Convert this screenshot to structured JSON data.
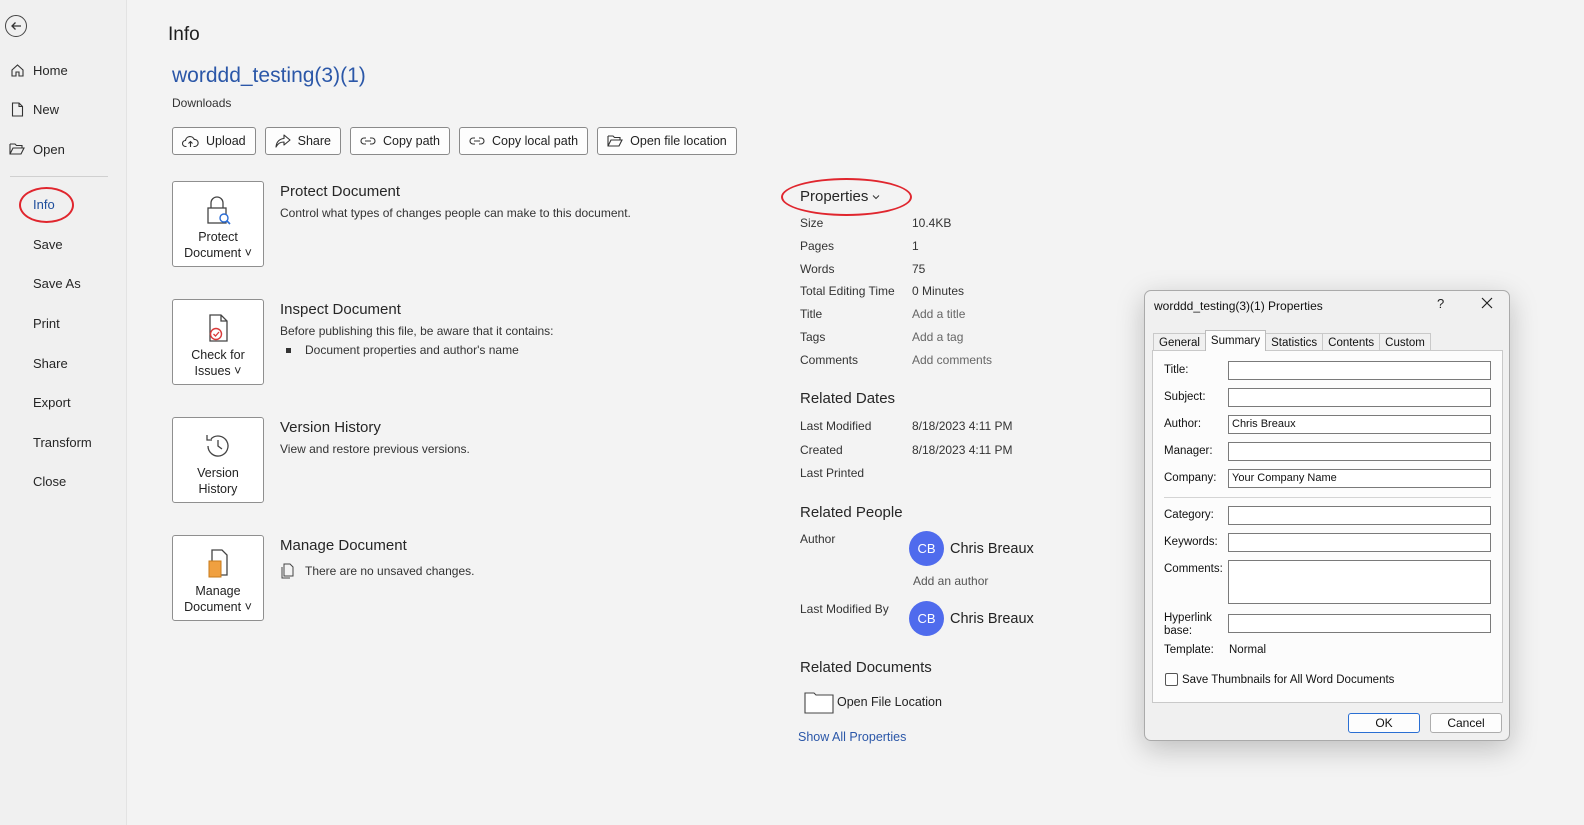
{
  "sidebar": {
    "items": [
      {
        "label": "Home",
        "icon": "home-icon"
      },
      {
        "label": "New",
        "icon": "new-document-icon"
      },
      {
        "label": "Open",
        "icon": "folder-open-icon"
      },
      {
        "label": "Info"
      },
      {
        "label": "Save"
      },
      {
        "label": "Save As"
      },
      {
        "label": "Print"
      },
      {
        "label": "Share"
      },
      {
        "label": "Export"
      },
      {
        "label": "Transform"
      },
      {
        "label": "Close"
      }
    ],
    "active": "Info"
  },
  "page": {
    "title": "Info",
    "doc_name": "worddd_testing(3)(1)",
    "doc_location": "Downloads"
  },
  "toolbar": {
    "upload": "Upload",
    "share": "Share",
    "copy_path": "Copy path",
    "copy_local_path": "Copy local path",
    "open_file_location": "Open file location"
  },
  "sections": {
    "protect": {
      "tile_line1": "Protect",
      "tile_line2": "Document",
      "title": "Protect Document",
      "desc": "Control what types of changes people can make to this document."
    },
    "inspect": {
      "tile_line1": "Check for",
      "tile_line2": "Issues",
      "title": "Inspect Document",
      "desc": "Before publishing this file, be aware that it contains:",
      "bullet": "Document properties and author's name"
    },
    "version": {
      "tile_line1": "Version",
      "tile_line2": "History",
      "title": "Version History",
      "desc": "View and restore previous versions."
    },
    "manage": {
      "tile_line1": "Manage",
      "tile_line2": "Document",
      "title": "Manage Document",
      "desc": "There are no unsaved changes."
    }
  },
  "properties": {
    "title": "Properties",
    "rows": {
      "size": {
        "k": "Size",
        "v": "10.4KB"
      },
      "pages": {
        "k": "Pages",
        "v": "1"
      },
      "words": {
        "k": "Words",
        "v": "75"
      },
      "editing": {
        "k": "Total Editing Time",
        "v": "0 Minutes"
      },
      "title": {
        "k": "Title",
        "v": "Add a title"
      },
      "tags": {
        "k": "Tags",
        "v": "Add a tag"
      },
      "comments": {
        "k": "Comments",
        "v": "Add comments"
      }
    },
    "related_dates": {
      "title": "Related Dates",
      "last_modified": {
        "k": "Last Modified",
        "v": "8/18/2023 4:11 PM"
      },
      "created": {
        "k": "Created",
        "v": "8/18/2023 4:11 PM"
      },
      "last_printed": {
        "k": "Last Printed",
        "v": ""
      }
    },
    "related_people": {
      "title": "Related People",
      "author_label": "Author",
      "author_initials": "CB",
      "author_name": "Chris Breaux",
      "add_author": "Add an author",
      "modified_by_label": "Last Modified By",
      "modified_initials": "CB",
      "modified_name": "Chris Breaux"
    },
    "related_documents": {
      "title": "Related Documents",
      "open_location": "Open File Location"
    },
    "show_all": "Show All Properties"
  },
  "dialog": {
    "title": "worddd_testing(3)(1) Properties",
    "help": "?",
    "tabs": [
      "General",
      "Summary",
      "Statistics",
      "Contents",
      "Custom"
    ],
    "active_tab": "Summary",
    "fields": {
      "title": {
        "label": "Title:",
        "value": ""
      },
      "subject": {
        "label": "Subject:",
        "value": ""
      },
      "author": {
        "label": "Author:",
        "value": "Chris Breaux"
      },
      "manager": {
        "label": "Manager:",
        "value": ""
      },
      "company": {
        "label": "Company:",
        "value": "Your Company Name"
      },
      "category": {
        "label": "Category:",
        "value": ""
      },
      "keywords": {
        "label": "Keywords:",
        "value": ""
      },
      "comments": {
        "label": "Comments:",
        "value": ""
      },
      "hyperlink_line1": "Hyperlink",
      "hyperlink_line2": "base:",
      "hyperlink_value": "",
      "template_label": "Template:",
      "template_value": "Normal"
    },
    "checkbox": "Save Thumbnails for All Word Documents",
    "ok": "OK",
    "cancel": "Cancel"
  },
  "colors": {
    "accent": "#2b57a8",
    "annotation_red": "#e0262e",
    "avatar": "#4f6bed"
  }
}
